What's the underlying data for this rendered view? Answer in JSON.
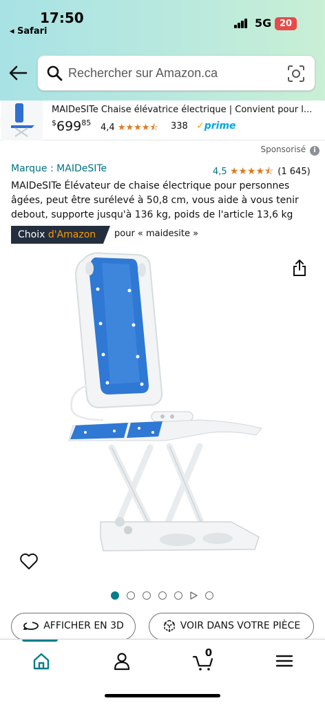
{
  "status_bar": {
    "time": "17:50",
    "back_app": "◂ Safari",
    "network": "5G",
    "battery": "20"
  },
  "search": {
    "placeholder": "Rechercher sur Amazon.ca"
  },
  "sticky_product": {
    "title": "MAIDeSITe Chaise élévatrice électrique | Convient pour l...",
    "price_symbol": "$",
    "price_whole": "699",
    "price_fraction": "85",
    "rating": "4,4",
    "stars": "★★★★⯪",
    "review_count": "338",
    "prime_label": "prime",
    "prime_check": "✓"
  },
  "sponsored_label": "Sponsorisé",
  "product": {
    "brand": "Marque : MAIDeSITe",
    "rating": "4,5",
    "stars": "★★★★⯪",
    "review_count": "(1 645)",
    "title": "MAIDeSITe Élévateur de chaise électrique pour personnes âgées, peut être surélevé à 50,8 cm, vous aide à vous tenir debout, supporte jusqu'à 136 kg, poids de l'article 13,6 kg"
  },
  "badge": {
    "choice": "Choix ",
    "amazon": "d'Amazon",
    "for_text": "pour « maidesite »"
  },
  "carousel": {
    "total_dots": 7,
    "active_index": 0
  },
  "actions": {
    "view_3d": "AFFICHER EN 3D",
    "view_in_room": "VOIR DANS VOTRE PIÈCE"
  },
  "nav": {
    "cart_count": "0",
    "items": [
      "home-icon",
      "account-icon",
      "cart-icon",
      "menu-icon"
    ]
  },
  "colors": {
    "accent": "#067d8a",
    "link": "#007185",
    "star": "#de7921",
    "badge_bg": "#232f3e"
  }
}
